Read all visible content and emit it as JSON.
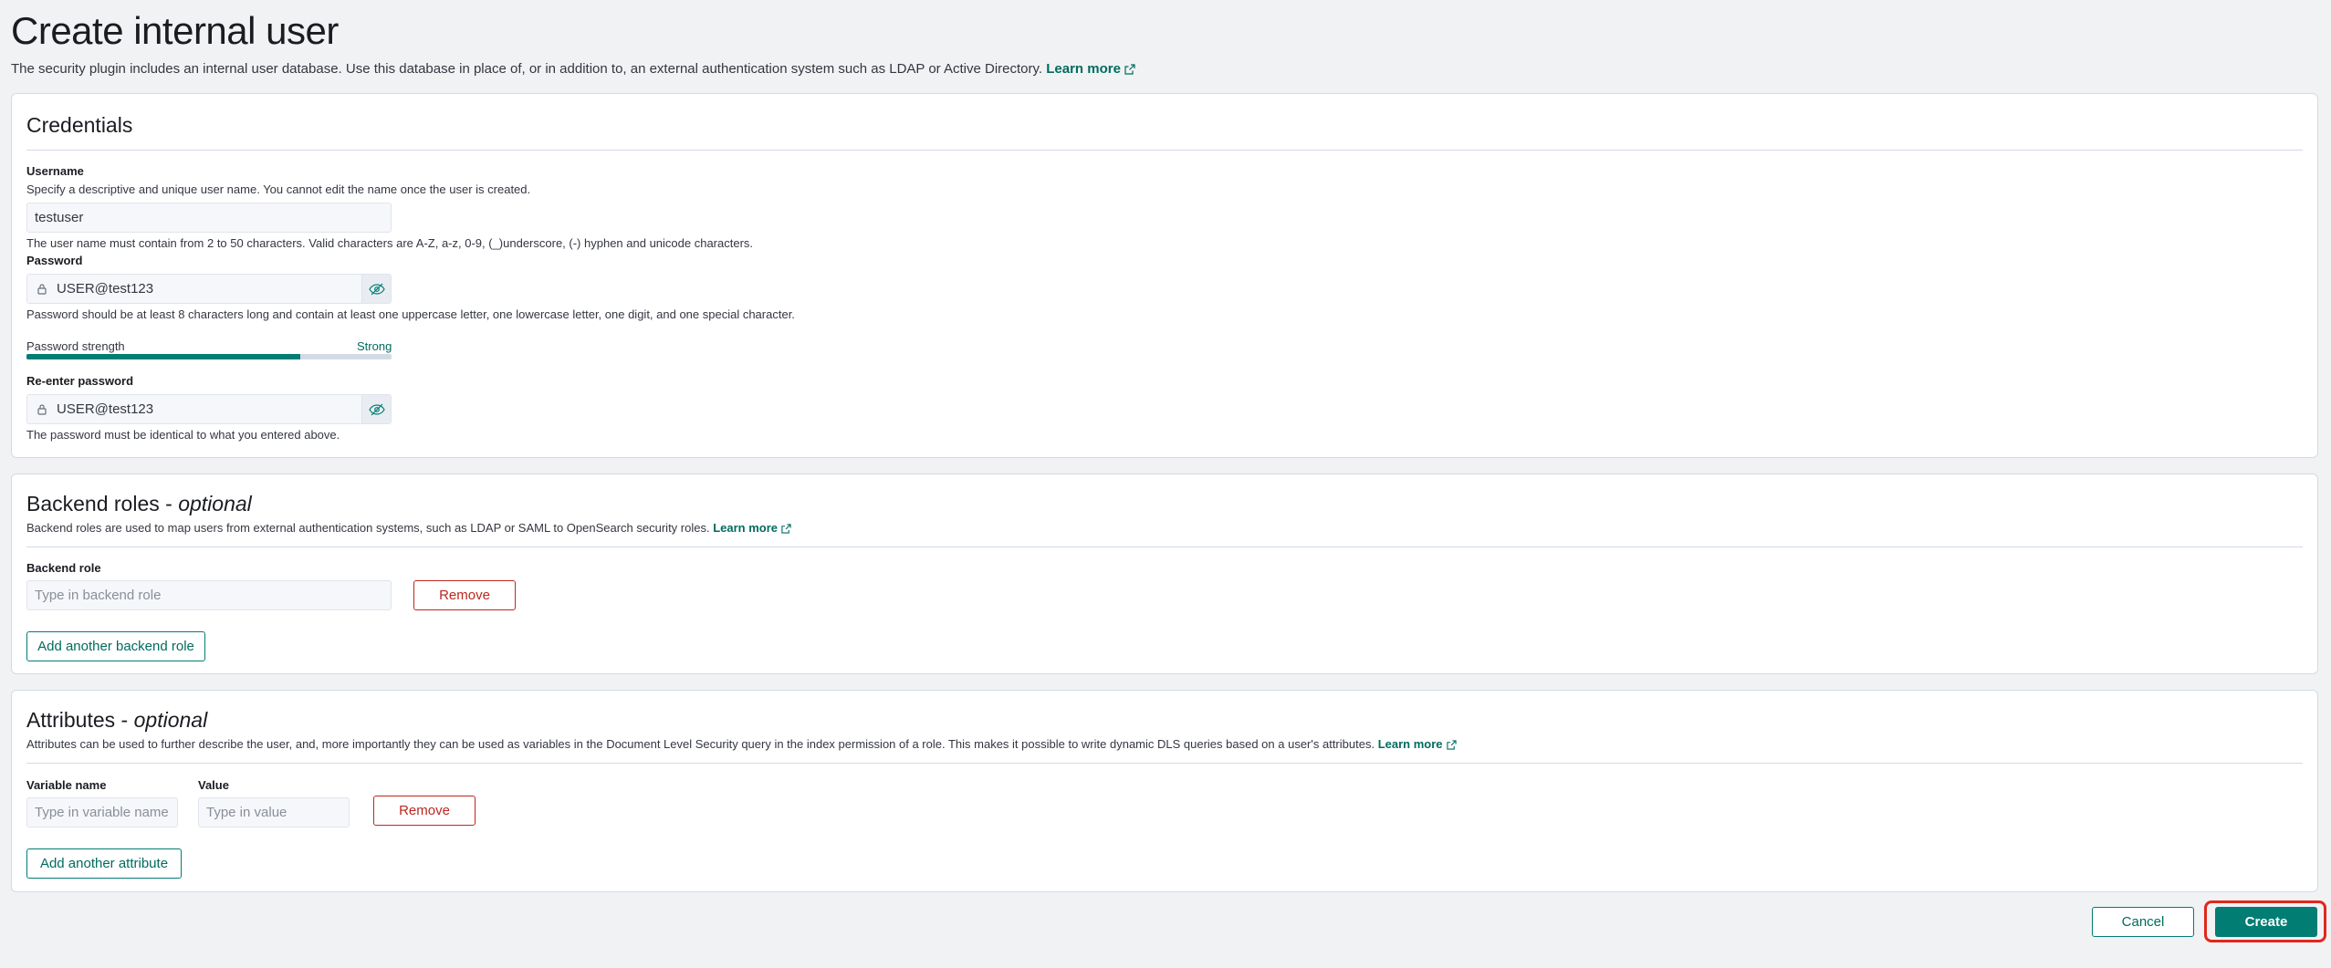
{
  "header": {
    "title": "Create internal user",
    "description": "The security plugin includes an internal user database. Use this database in place of, or in addition to, an external authentication system such as LDAP or Active Directory.",
    "learn_more": "Learn more"
  },
  "credentials": {
    "title": "Credentials",
    "username": {
      "label": "Username",
      "description": "Specify a descriptive and unique user name. You cannot edit the name once the user is created.",
      "value": "testuser",
      "help": "The user name must contain from 2 to 50 characters. Valid characters are A-Z, a-z, 0-9, (_)underscore, (-) hyphen and unicode characters."
    },
    "password": {
      "label": "Password",
      "value": "USER@test123",
      "help": "Password should be at least 8 characters long and contain at least one uppercase letter, one lowercase letter, one digit, and one special character.",
      "strength_label": "Password strength",
      "strength_value": "Strong",
      "strength_fraction": 0.75
    },
    "reenter": {
      "label": "Re-enter password",
      "value": "USER@test123",
      "help": "The password must be identical to what you entered above."
    }
  },
  "backend_roles": {
    "title": "Backend roles - ",
    "title_optional": "optional",
    "description": "Backend roles are used to map users from external authentication systems, such as LDAP or SAML to OpenSearch security roles.",
    "learn_more": "Learn more",
    "field_label": "Backend role",
    "placeholder": "Type in backend role",
    "remove_label": "Remove",
    "add_label": "Add another backend role"
  },
  "attributes": {
    "title": "Attributes - ",
    "title_optional": "optional",
    "description": "Attributes can be used to further describe the user, and, more importantly they can be used as variables in the Document Level Security query in the index permission of a role. This makes it possible to write dynamic DLS queries based on a user's attributes.",
    "learn_more": "Learn more",
    "variable_label": "Variable name",
    "variable_placeholder": "Type in variable name",
    "value_label": "Value",
    "value_placeholder": "Type in value",
    "remove_label": "Remove",
    "add_label": "Add another attribute"
  },
  "footer": {
    "cancel_label": "Cancel",
    "create_label": "Create"
  },
  "colors": {
    "primary": "#017d73",
    "danger": "#bd271e",
    "highlight": "#e0281c"
  }
}
